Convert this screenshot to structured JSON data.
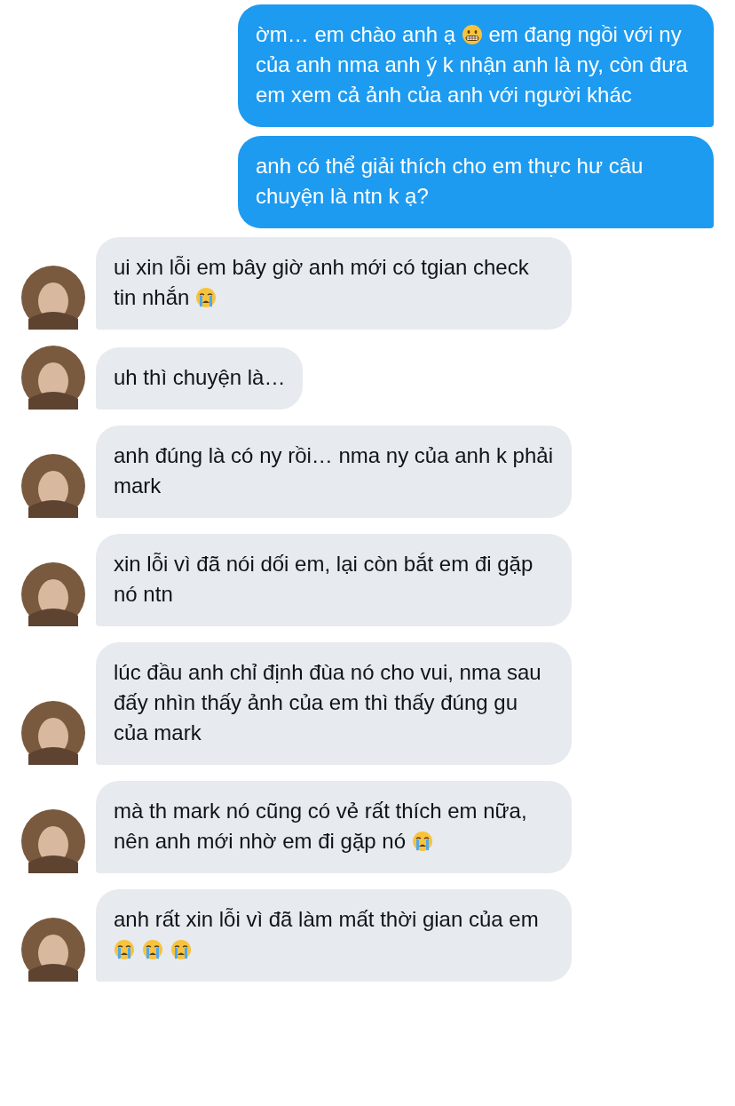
{
  "messages": [
    {
      "kind": "sent",
      "parts": [
        {
          "kind": "text",
          "text": "ờm… em chào anh ạ "
        },
        {
          "kind": "grimace"
        },
        {
          "kind": "text",
          "text": " em đang ngồi với ny của anh nma anh ý k nhận anh là ny, còn đưa em xem cả ảnh của anh với người khác"
        }
      ]
    },
    {
      "kind": "sent",
      "parts": [
        {
          "kind": "text",
          "text": "anh có thể giải thích cho em thực hư câu chuyện là ntn k ạ?"
        }
      ]
    },
    {
      "kind": "received",
      "parts": [
        {
          "kind": "text",
          "text": "ui xin lỗi em bây giờ anh mới có tgian check tin nhắn "
        },
        {
          "kind": "cry"
        }
      ]
    },
    {
      "kind": "received",
      "parts": [
        {
          "kind": "text",
          "text": "uh thì chuyện là…"
        }
      ]
    },
    {
      "kind": "received",
      "parts": [
        {
          "kind": "text",
          "text": "anh đúng là có ny rồi… nma ny của anh k phải mark"
        }
      ]
    },
    {
      "kind": "received",
      "parts": [
        {
          "kind": "text",
          "text": "xin lỗi vì đã nói dối em, lại còn bắt em đi gặp nó ntn"
        }
      ]
    },
    {
      "kind": "received",
      "parts": [
        {
          "kind": "text",
          "text": "lúc đầu anh chỉ định đùa nó cho vui, nma sau đấy nhìn thấy ảnh của em thì thấy đúng gu của mark"
        }
      ]
    },
    {
      "kind": "received",
      "parts": [
        {
          "kind": "text",
          "text": "mà th mark nó cũng có vẻ rất thích em nữa, nên anh mới nhờ em đi gặp nó "
        },
        {
          "kind": "cry"
        }
      ]
    },
    {
      "kind": "received",
      "parts": [
        {
          "kind": "text",
          "text": "anh rất xin lỗi vì đã làm mất thời gian của em "
        },
        {
          "kind": "cry"
        },
        {
          "kind": "cry"
        },
        {
          "kind": "cry"
        }
      ]
    }
  ]
}
